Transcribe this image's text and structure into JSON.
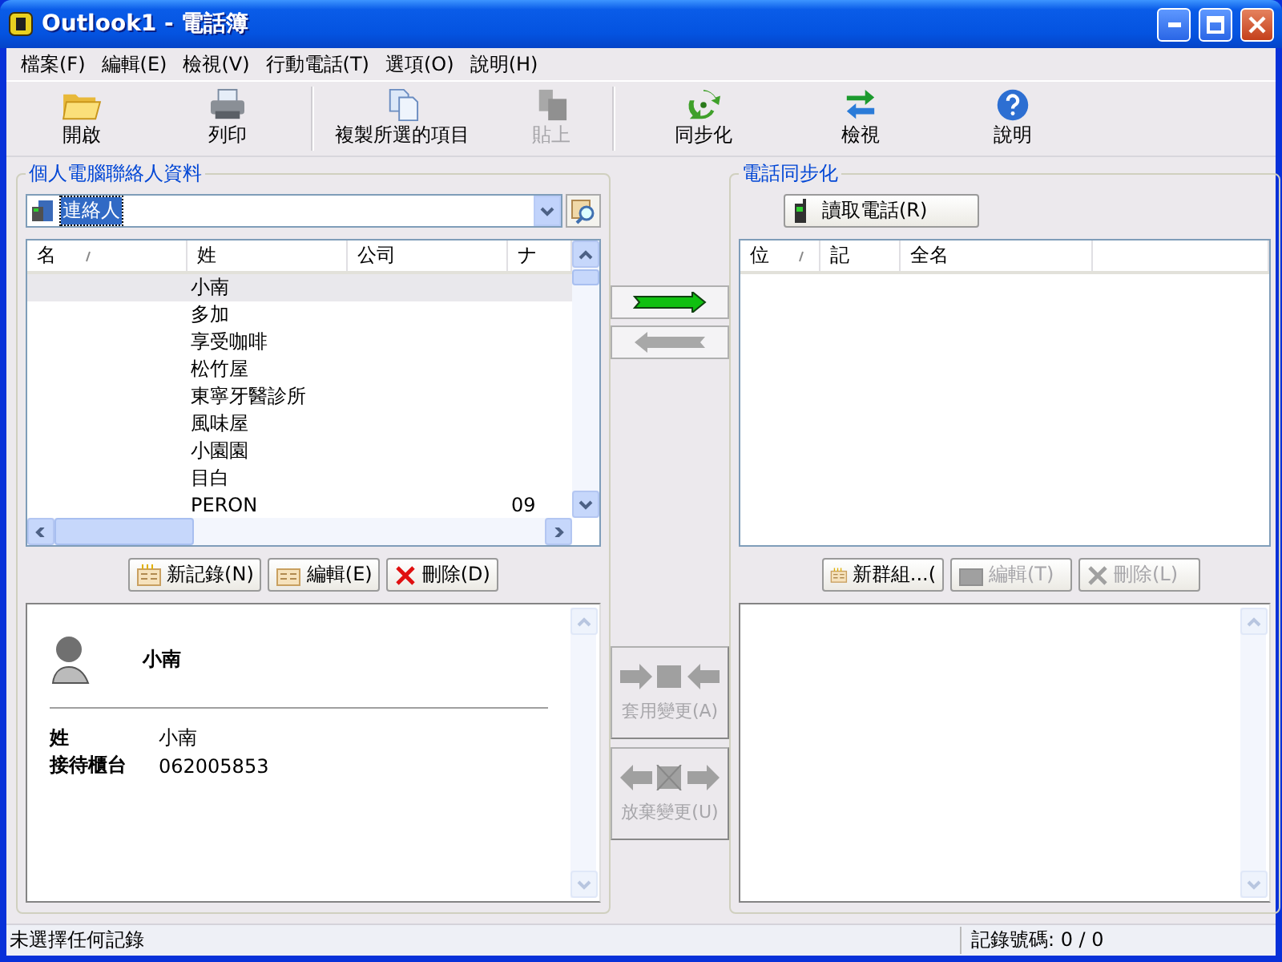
{
  "window": {
    "title": "Outlook1 - 電話簿"
  },
  "menu": [
    "檔案(F)",
    "編輯(E)",
    "檢視(V)",
    "行動電話(T)",
    "選項(O)",
    "說明(H)"
  ],
  "toolbar": [
    {
      "label": "開啟",
      "disabled": false
    },
    {
      "label": "列印",
      "disabled": false
    },
    {
      "label": "複製所選的項目",
      "disabled": false
    },
    {
      "label": "貼上",
      "disabled": true
    },
    {
      "label": "同步化",
      "disabled": false
    },
    {
      "label": "檢視",
      "disabled": false
    },
    {
      "label": "說明",
      "disabled": false
    }
  ],
  "left_panel": {
    "title": "個人電腦聯絡人資料",
    "folder": {
      "value": "連絡人"
    },
    "list": {
      "columns": [
        {
          "label": "名",
          "sorted": true
        },
        {
          "label": "姓",
          "sorted": false
        },
        {
          "label": "公司",
          "sorted": false
        },
        {
          "label": "ナ",
          "sorted": false
        }
      ],
      "rows": [
        {
          "cells": [
            "",
            "小南",
            "",
            ""
          ],
          "selected": true
        },
        {
          "cells": [
            "",
            "多加",
            "",
            ""
          ],
          "selected": false
        },
        {
          "cells": [
            "",
            "享受咖啡",
            "",
            ""
          ],
          "selected": false
        },
        {
          "cells": [
            "",
            "松竹屋",
            "",
            ""
          ],
          "selected": false
        },
        {
          "cells": [
            "",
            "東寧牙醫診所",
            "",
            ""
          ],
          "selected": false
        },
        {
          "cells": [
            "",
            "風味屋",
            "",
            ""
          ],
          "selected": false
        },
        {
          "cells": [
            "",
            "小園園",
            "",
            ""
          ],
          "selected": false
        },
        {
          "cells": [
            "",
            "目白",
            "",
            ""
          ],
          "selected": false
        },
        {
          "cells": [
            "",
            "PERON",
            "",
            "09"
          ],
          "selected": false
        }
      ]
    },
    "buttons": [
      {
        "label": "新記錄(N)",
        "disabled": false
      },
      {
        "label": "編輯(E)",
        "disabled": false
      },
      {
        "label": "刪除(D)",
        "disabled": false
      }
    ],
    "detail": {
      "name": "小南",
      "fields": [
        {
          "label": "姓",
          "value": "小南"
        },
        {
          "label": "接待櫃台",
          "value": "062005853"
        }
      ]
    }
  },
  "transfer": {
    "arrows": [
      {
        "disabled": false
      },
      {
        "disabled": true
      }
    ],
    "actions": [
      {
        "label": "套用變更(A)",
        "disabled": true
      },
      {
        "label": "放棄變更(U)",
        "disabled": true
      }
    ]
  },
  "right_panel": {
    "title": "電話同步化",
    "read_button": "讀取電話(R)",
    "list": {
      "columns": [
        {
          "label": "位",
          "sorted": true
        },
        {
          "label": "記",
          "sorted": false
        },
        {
          "label": "全名",
          "sorted": false
        }
      ]
    },
    "buttons": [
      {
        "label": "新群組...(",
        "disabled": false
      },
      {
        "label": "編輯(T)",
        "disabled": true
      },
      {
        "label": "刪除(L)",
        "disabled": true
      }
    ]
  },
  "status_bar": [
    "未選擇任何記錄",
    "記錄號碼: 0 / 0"
  ]
}
